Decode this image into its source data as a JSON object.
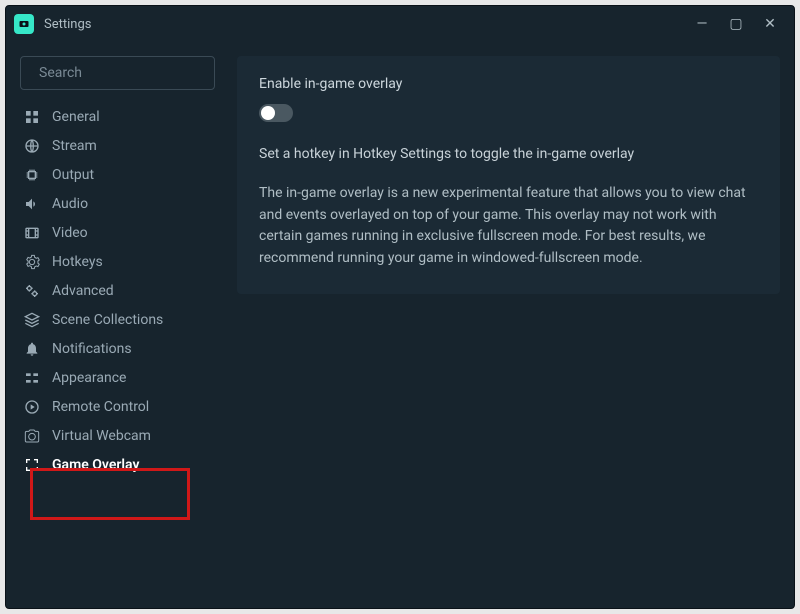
{
  "window": {
    "title": "Settings"
  },
  "search": {
    "placeholder": "Search"
  },
  "sidebar": {
    "items": [
      {
        "label": "General"
      },
      {
        "label": "Stream"
      },
      {
        "label": "Output"
      },
      {
        "label": "Audio"
      },
      {
        "label": "Video"
      },
      {
        "label": "Hotkeys"
      },
      {
        "label": "Advanced"
      },
      {
        "label": "Scene Collections"
      },
      {
        "label": "Notifications"
      },
      {
        "label": "Appearance"
      },
      {
        "label": "Remote Control"
      },
      {
        "label": "Virtual Webcam"
      },
      {
        "label": "Game Overlay"
      }
    ]
  },
  "panel": {
    "enable_label": "Enable in-game overlay",
    "hint": "Set a hotkey in Hotkey Settings to toggle the in-game overlay",
    "description": "The in-game overlay is a new experimental feature that allows you to view chat and events overlayed on top of your game. This overlay may not work with certain games running in exclusive fullscreen mode. For best results, we recommend running your game in windowed-fullscreen mode."
  }
}
